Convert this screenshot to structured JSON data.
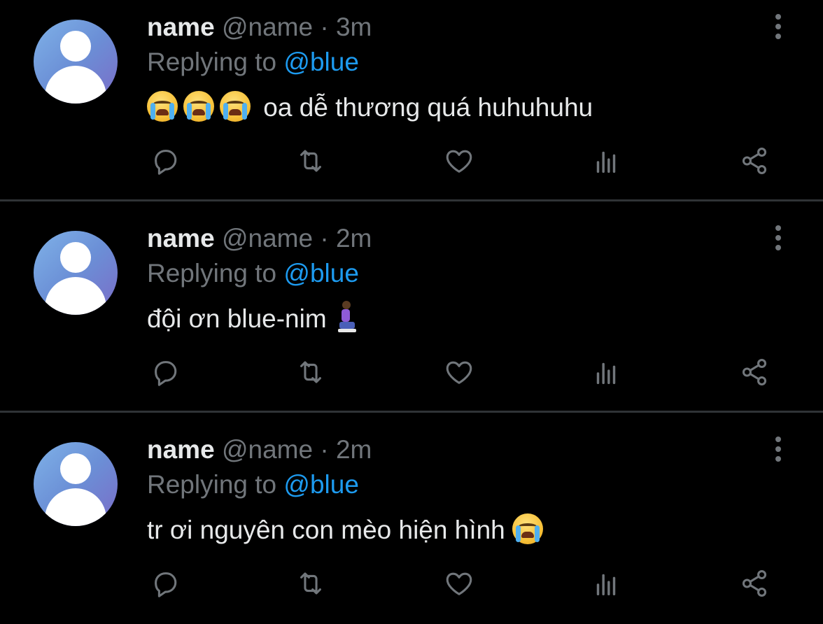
{
  "colors": {
    "background": "#000000",
    "primary_text": "#e7e9ea",
    "secondary_text": "#71767b",
    "accent": "#1d9bf0",
    "divider": "#2f3336"
  },
  "replies": [
    {
      "display_name": "name",
      "handle": "@name",
      "separator": "·",
      "time": "3m",
      "replying_prefix": "Replying to",
      "replying_to": "@blue",
      "emoji_before": [
        "loudly-crying-face",
        "loudly-crying-face",
        "loudly-crying-face"
      ],
      "text": "oa dễ thương quá huhuhuhu",
      "emoji_after": []
    },
    {
      "display_name": "name",
      "handle": "@name",
      "separator": "·",
      "time": "2m",
      "replying_prefix": "Replying to",
      "replying_to": "@blue",
      "emoji_before": [],
      "text": "đội ơn blue-nim",
      "emoji_after": [
        "woman-kneeling"
      ]
    },
    {
      "display_name": "name",
      "handle": "@name",
      "separator": "·",
      "time": "2m",
      "replying_prefix": "Replying to",
      "replying_to": "@blue",
      "emoji_before": [],
      "text": "tr ơi nguyên con mèo hiện hình",
      "emoji_after": [
        "loudly-crying-face"
      ]
    }
  ],
  "action_icons": [
    "reply-icon",
    "retweet-icon",
    "like-icon",
    "views-icon",
    "share-icon"
  ],
  "menu_icon": "more-vertical-icon"
}
